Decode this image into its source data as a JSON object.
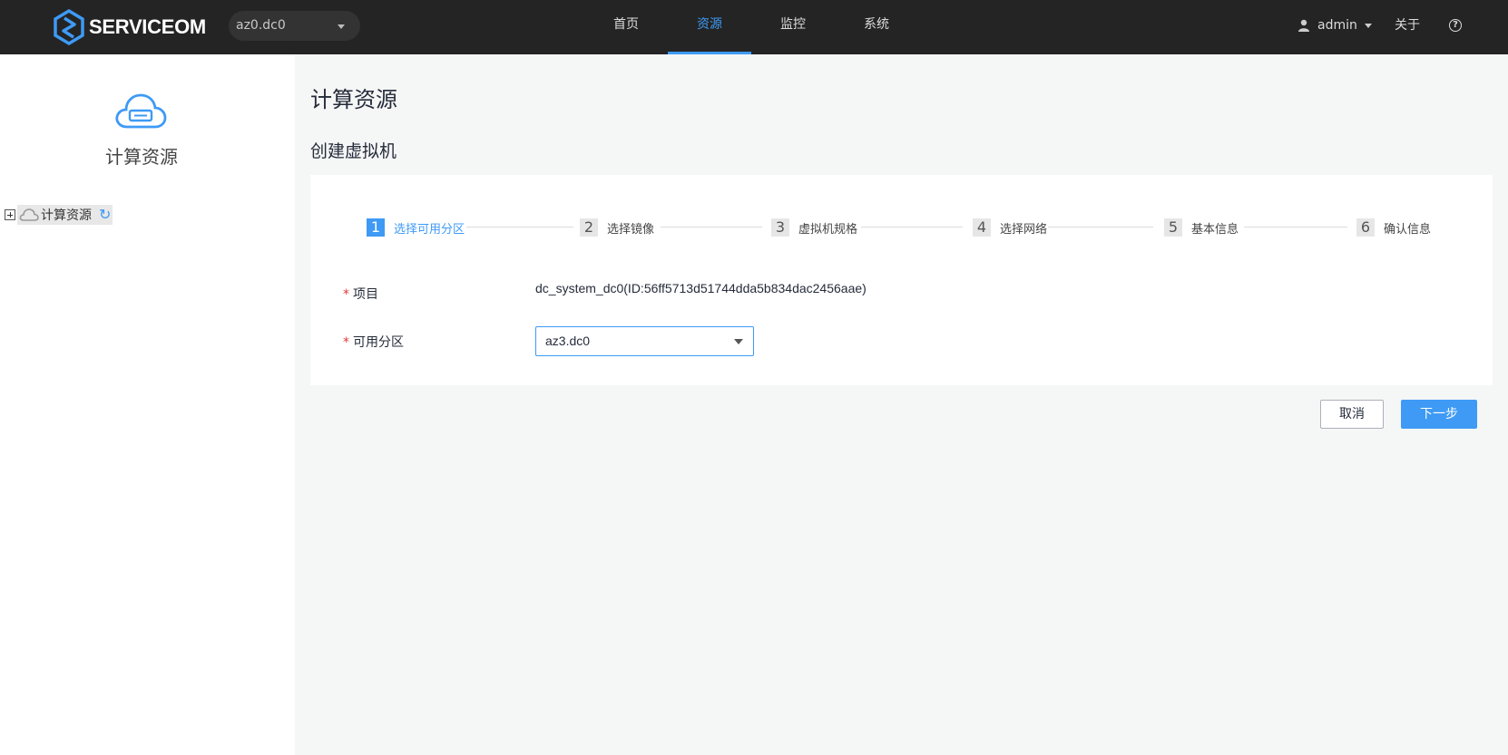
{
  "header": {
    "logo_text": "SERVICE",
    "logo_text_om": "OM",
    "region_value": "az0.dc0",
    "nav": [
      {
        "label": "首页",
        "active": false
      },
      {
        "label": "资源",
        "active": true
      },
      {
        "label": "监控",
        "active": false
      },
      {
        "label": "系统",
        "active": false
      }
    ],
    "user": "admin",
    "about": "关于",
    "help_glyph": "?",
    "accent_color": "#3e9af5",
    "bar_color": "#242424"
  },
  "sidebar": {
    "title": "计算资源",
    "tree": {
      "root_label": "计算资源",
      "refresh_glyph": "↻"
    }
  },
  "main": {
    "page_title": "计算资源",
    "section_title": "创建虚拟机",
    "steps": [
      {
        "num": "1",
        "label": "选择可用分区",
        "active": true
      },
      {
        "num": "2",
        "label": "选择镜像",
        "active": false
      },
      {
        "num": "3",
        "label": "虚拟机规格",
        "active": false
      },
      {
        "num": "4",
        "label": "选择网络",
        "active": false
      },
      {
        "num": "5",
        "label": "基本信息",
        "active": false
      },
      {
        "num": "6",
        "label": "确认信息",
        "active": false
      }
    ],
    "form": {
      "required_mark": "*",
      "project_label": "项目",
      "project_value": "dc_system_dc0(ID:56ff5713d51744dda5b834dac2456aae)",
      "az_label": "可用分区",
      "az_value": "az3.dc0"
    },
    "buttons": {
      "cancel": "取消",
      "next": "下一步"
    }
  }
}
